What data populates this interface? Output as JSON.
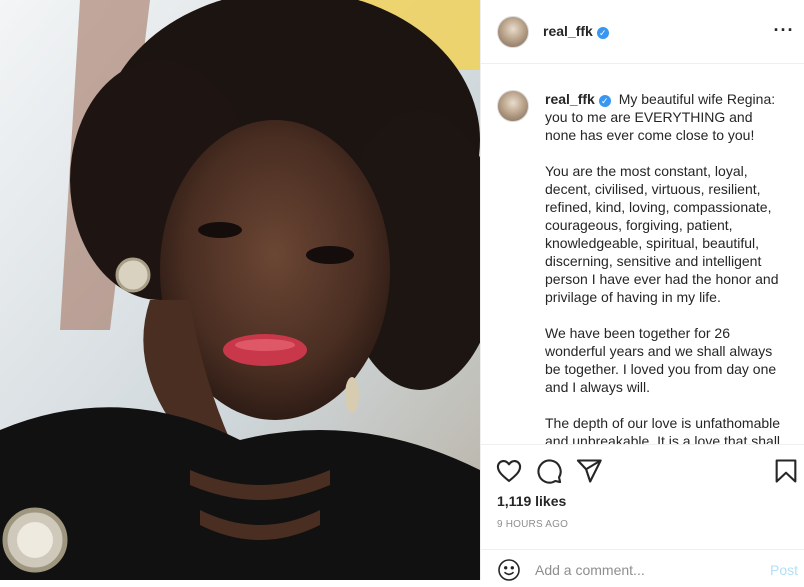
{
  "post": {
    "username": "real_ffk",
    "verified": true
  },
  "header": {
    "more_icon": "more-horizontal-icon"
  },
  "caption": {
    "username": "real_ffk",
    "paragraphs": [
      "My beautiful wife Regina: you to me are EVERYTHING and none has ever come close to you!",
      "You are the most constant, loyal, decent, civilised, virtuous, resilient, refined, kind, loving, compassionate, courageous, forgiving, patient, knowledgeable, spiritual, beautiful, discerning, sensitive and intelligent person I have ever had the honor and privilage of having in my life.",
      "We have been together for 26 wonderful years and we shall always be together. I loved you from day one and I always will.",
      "The depth of our love is unfathomable and unbreakable. It is a love that shall"
    ]
  },
  "actions": {
    "icons": [
      "heart-icon",
      "comment-icon",
      "share-icon",
      "bookmark-icon"
    ],
    "likes": "1,119 likes",
    "timestamp": "9 HOURS AGO"
  },
  "comment": {
    "placeholder": "Add a comment...",
    "post_label": "Post"
  },
  "colors": {
    "verified_blue": "#3897f0",
    "post_disabled": "#b2dffc",
    "muted_text": "#8e8e8e",
    "border": "#efefef"
  }
}
